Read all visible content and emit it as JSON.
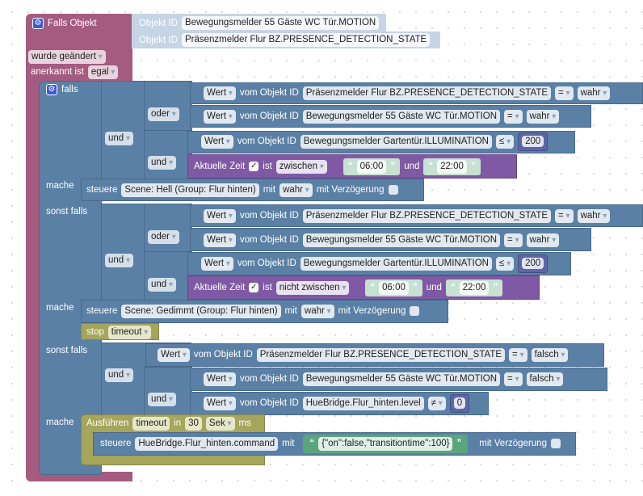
{
  "event": {
    "title": "Falls Objekt",
    "objects": [
      {
        "label": "Objekt ID",
        "id": "Bewegungsmelder 55 Gäste WC Tür.MOTION"
      },
      {
        "label": "Objekt ID",
        "id": "Präsenzmelder Flur BZ.PRESENCE_DETECTION_STATE"
      }
    ],
    "trigger": "wurde geändert",
    "ack_label": "anerkannt ist",
    "ack_value": "egal"
  },
  "ifblock": {
    "falls": "falls",
    "mache": "mache",
    "sonst_falls": "sonst falls"
  },
  "ops": {
    "und": "und",
    "oder": "oder"
  },
  "conds": [
    {
      "kind": "Wert",
      "of": "vom Objekt ID",
      "id": "Präsenzmelder Flur BZ.PRESENCE_DETECTION_STATE",
      "op": "=",
      "value": "wahr"
    },
    {
      "kind": "Wert",
      "of": "vom Objekt ID",
      "id": "Bewegungsmelder 55 Gäste WC Tür.MOTION",
      "op": "=",
      "value": "wahr"
    },
    {
      "kind": "Wert",
      "of": "vom Objekt ID",
      "id": "Bewegungsmelder Gartentür.ILLUMINATION",
      "op": "≤",
      "value": "200"
    },
    {
      "kind": "Wert",
      "of": "vom Objekt ID",
      "id": "Präsenzmelder Flur BZ.PRESENCE_DETECTION_STATE",
      "op": "=",
      "value": "wahr"
    },
    {
      "kind": "Wert",
      "of": "vom Objekt ID",
      "id": "Bewegungsmelder 55 Gäste WC Tür.MOTION",
      "op": "=",
      "value": "wahr"
    },
    {
      "kind": "Wert",
      "of": "vom Objekt ID",
      "id": "Bewegungsmelder Gartentür.ILLUMINATION",
      "op": "≤",
      "value": "200"
    },
    {
      "kind": "Wert",
      "of": "vom Objekt ID",
      "id": "Präsenzmelder Flur BZ.PRESENCE_DETECTION_STATE",
      "op": "=",
      "value": "falsch"
    },
    {
      "kind": "Wert",
      "of": "vom Objekt ID",
      "id": "Bewegungsmelder 55 Gäste WC Tür.MOTION",
      "op": "=",
      "value": "falsch"
    },
    {
      "kind": "Wert",
      "of": "vom Objekt ID",
      "id": "HueBridge.Flur_hinten.level",
      "op": "≠",
      "value": "0"
    }
  ],
  "times": [
    {
      "label": "Aktuelle Zeit",
      "ist": "ist",
      "mode": "zwischen",
      "from": "06:00",
      "und": "und",
      "to": "22:00"
    },
    {
      "label": "Aktuelle Zeit",
      "ist": "ist",
      "mode": "nicht zwischen",
      "from": "06:00",
      "und": "und",
      "to": "22:00"
    }
  ],
  "controls": [
    {
      "label": "steuere",
      "target": "Scene: Hell (Group: Flur hinten)",
      "mit": "mit",
      "value": "wahr",
      "delay": "mit Verzögerung"
    },
    {
      "label": "steuere",
      "target": "Scene: Gedimmt (Group: Flur hinten)",
      "mit": "mit",
      "value": "wahr",
      "delay": "mit Verzögerung"
    },
    {
      "label": "steuere",
      "target": "HueBridge.Flur_hinten.command",
      "mit": "mit",
      "value": "{\"on\":false,\"transitiontime\":100}",
      "delay": "mit Verzögerung"
    }
  ],
  "stop": {
    "label": "stop",
    "timer": "timeout"
  },
  "run": {
    "label": "Ausführen",
    "timer": "timeout",
    "in": "in",
    "amount": "30",
    "unit": "Sek",
    "suffix": "ms"
  },
  "colors": {
    "event": "#a55b80",
    "logic": "#5b80a5",
    "time": "#8059a5",
    "timeout": "#a5a55b",
    "objectid": "#c6d4e5",
    "text": "#5ba57e"
  }
}
